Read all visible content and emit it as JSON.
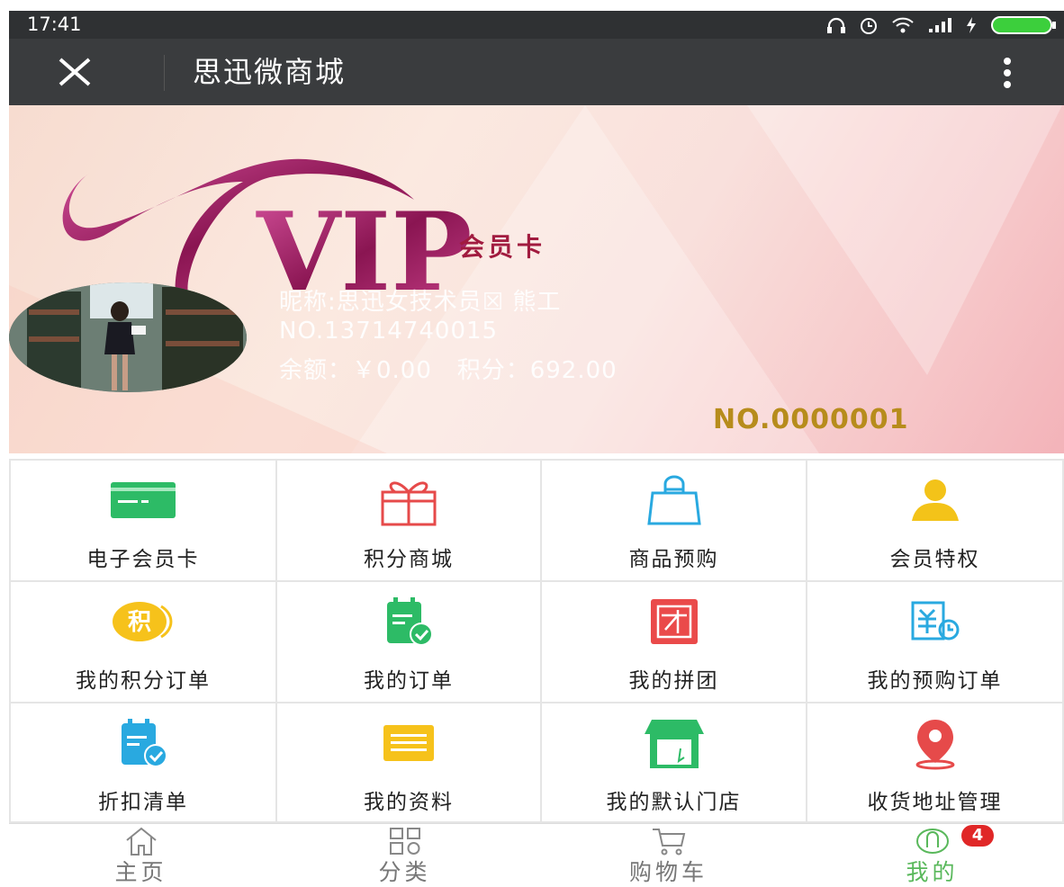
{
  "status_bar": {
    "time": "17:41"
  },
  "header": {
    "title": "思迅微商城"
  },
  "vip_card": {
    "logo_text": "VIP",
    "card_word": "会员卡",
    "nickname": "昵称:思迅女技术员☒ 熊工",
    "phone": "NO.13714740015",
    "balance_text": "余额：￥0.00",
    "points_text": "积分：692.00",
    "card_no": "NO.0000001"
  },
  "grid": {
    "items": [
      {
        "label": "电子会员卡",
        "icon": "card-icon",
        "color": "#2dbb66"
      },
      {
        "label": "积分商城",
        "icon": "gift-icon",
        "color": "#e64a4a"
      },
      {
        "label": "商品预购",
        "icon": "shopping-bag-icon",
        "color": "#29a9e0"
      },
      {
        "label": "会员特权",
        "icon": "member-icon",
        "color": "#f3c319"
      },
      {
        "label": "我的积分订单",
        "icon": "points-icon",
        "color": "#f6c21b"
      },
      {
        "label": "我的订单",
        "icon": "order-calendar-icon",
        "color": "#2dbb66"
      },
      {
        "label": "我的拼团",
        "icon": "group-buy-icon",
        "color": "#ea4a4a"
      },
      {
        "label": "我的预购订单",
        "icon": "preorder-icon",
        "color": "#29a9e0"
      },
      {
        "label": "折扣清单",
        "icon": "discount-list-icon",
        "color": "#29a9e0"
      },
      {
        "label": "我的资料",
        "icon": "profile-doc-icon",
        "color": "#f6c21b"
      },
      {
        "label": "我的默认门店",
        "icon": "store-icon",
        "color": "#2dbb66"
      },
      {
        "label": "收货地址管理",
        "icon": "location-pin-icon",
        "color": "#e64a4a"
      }
    ]
  },
  "tabbar": {
    "items": [
      {
        "label": "主页",
        "icon": "home-icon"
      },
      {
        "label": "分类",
        "icon": "category-icon"
      },
      {
        "label": "购物车",
        "icon": "cart-icon"
      },
      {
        "label": "我的",
        "icon": "user-icon"
      }
    ],
    "active_index": 3,
    "badge": "4"
  },
  "colors": {
    "accent": "#59b85b",
    "badge": "#e02727",
    "card_no": "#b78c1c"
  }
}
